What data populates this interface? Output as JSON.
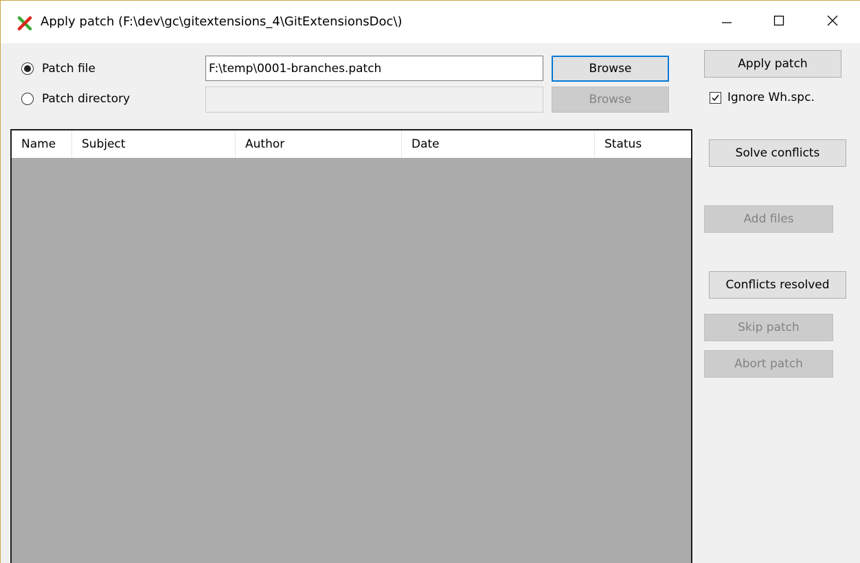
{
  "window": {
    "title": "Apply patch (F:\\dev\\gc\\gitextensions_4\\GitExtensionsDoc\\)",
    "icon": "git-extensions-logo-icon",
    "controls": {
      "minimize_icon": "minimize-icon",
      "maximize_icon": "maximize-icon",
      "close_icon": "close-icon"
    }
  },
  "source": {
    "patch_file_label": "Patch file",
    "patch_file_selected": true,
    "patch_file_value": "F:\\temp\\0001-branches.patch",
    "patch_dir_label": "Patch directory",
    "patch_dir_selected": false,
    "patch_dir_value": "",
    "browse_file_label": "Browse",
    "browse_dir_label": "Browse"
  },
  "actions": {
    "apply_patch_label": "Apply patch",
    "ignore_whitespace_label": "Ignore Wh.spc.",
    "ignore_whitespace_checked": true,
    "solve_conflicts_label": "Solve conflicts",
    "add_files_label": "Add files",
    "conflicts_resolved_label": "Conflicts resolved",
    "skip_patch_label": "Skip patch",
    "abort_patch_label": "Abort patch"
  },
  "grid": {
    "columns": [
      "Name",
      "Subject",
      "Author",
      "Date",
      "Status"
    ],
    "rows": []
  },
  "colors": {
    "accent_focus": "#0078d7",
    "grid_background": "#ababab",
    "disabled_button": "#cccccc"
  }
}
